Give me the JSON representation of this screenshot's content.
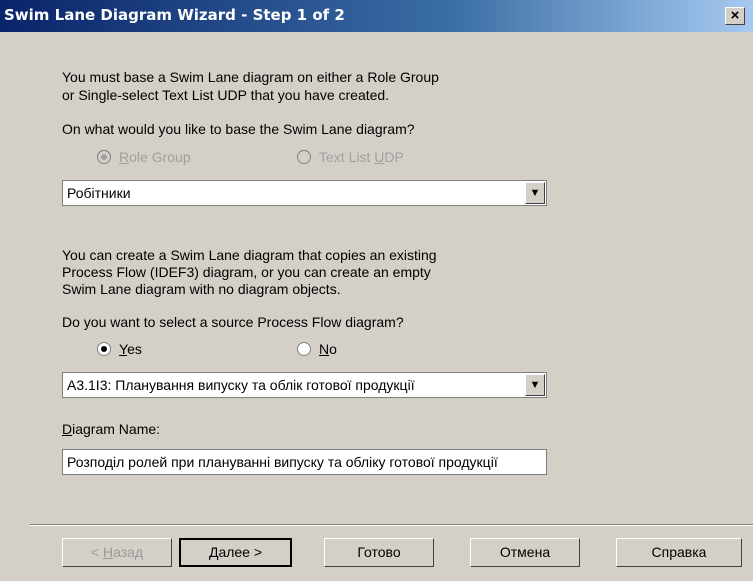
{
  "window": {
    "title": "Swim Lane Diagram Wizard - Step 1 of 2",
    "close_glyph": "×"
  },
  "intro": {
    "line1": "You must base a Swim Lane diagram on either a Role Group",
    "line2": "or Single-select Text List UDP that you have created."
  },
  "base_question": "On what would you like to base the Swim Lane diagram?",
  "base_options": [
    {
      "label_rest": "ole Group",
      "accel": "R",
      "selected": true,
      "enabled": false
    },
    {
      "label_pre": "Text List ",
      "accel": "U",
      "label_rest": "DP",
      "selected": false,
      "enabled": false
    }
  ],
  "base_combo": {
    "value": "Робітники"
  },
  "copy_info": {
    "line1": "You can create a Swim Lane diagram that copies an existing",
    "line2": "Process Flow (IDEF3) diagram, or you can create an empty",
    "line3": "Swim Lane diagram with no diagram objects."
  },
  "source_question": "Do you want to select a source Process Flow diagram?",
  "source_options": [
    {
      "accel": "Y",
      "label_rest": "es",
      "selected": true
    },
    {
      "accel": "N",
      "label_rest": "o",
      "selected": false
    }
  ],
  "source_combo": {
    "value": "A3.1I3:  Планування випуску  та облік готової  продукції"
  },
  "diagram_name": {
    "accel": "D",
    "label_rest": "iagram Name:",
    "value": "Розподіл ролей при плануванні випуску та обліку готової продукції"
  },
  "buttons": {
    "back": {
      "pre": "< ",
      "accel": "Н",
      "rest": "азад"
    },
    "next": {
      "accel": "Д",
      "rest": "алее >"
    },
    "finish": "Готово",
    "cancel": "Отмена",
    "help": "Справка"
  },
  "icons": {
    "dropdown": "▼"
  }
}
